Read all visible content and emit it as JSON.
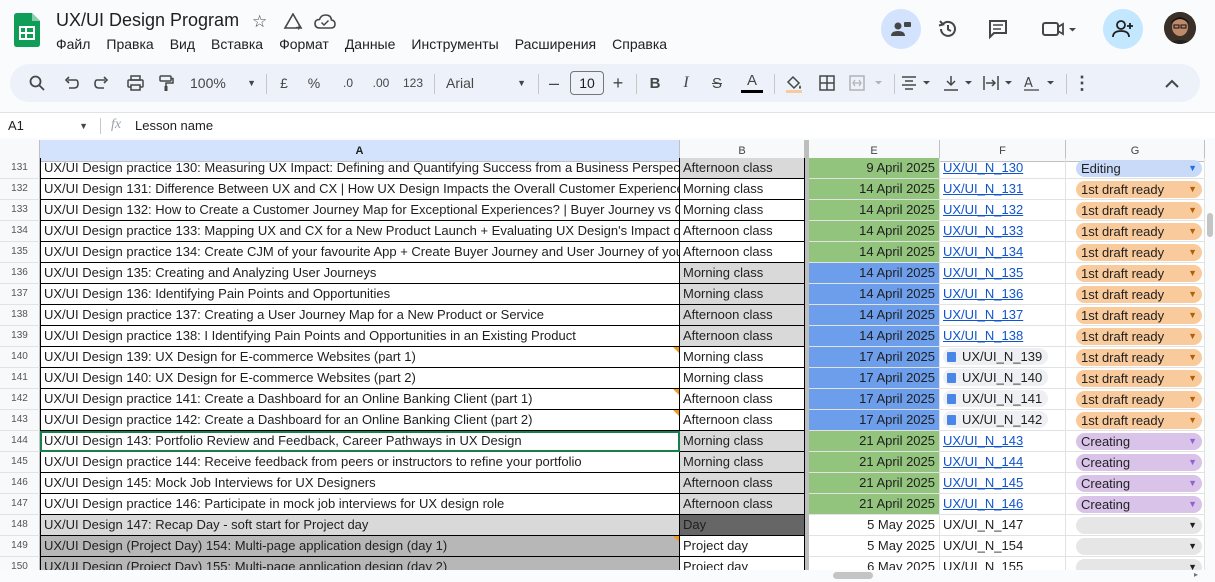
{
  "doc": {
    "title": "UX/UI Design Program",
    "menu": [
      "Файл",
      "Правка",
      "Вид",
      "Вставка",
      "Формат",
      "Данные",
      "Инструменты",
      "Расширения",
      "Справка"
    ]
  },
  "toolbar": {
    "zoom": "100%",
    "currency": "£",
    "percent": "%",
    "dec_decrease": ".0",
    "dec_increase": ".00",
    "number_format": "123",
    "font": "Arial",
    "font_size": "10",
    "bold": "B",
    "italic": "I",
    "strike": "S",
    "text_color": "A"
  },
  "formula": {
    "cell_ref": "A1",
    "fx": "fx",
    "value": "Lesson name"
  },
  "columns": [
    {
      "key": "A",
      "label": "A"
    },
    {
      "key": "B",
      "label": "B"
    },
    {
      "key": "E",
      "label": "E"
    },
    {
      "key": "F",
      "label": "F"
    },
    {
      "key": "G",
      "label": "G"
    }
  ],
  "colors": {
    "green": "#93c47d",
    "blue": "#6d9eeb",
    "gray_light": "#d9d9d9",
    "gray_mid": "#b7b7b7",
    "gray_dark": "#666666",
    "status_editing": "#c9daf8",
    "status_draft": "#f9cb9c",
    "status_creating": "#d9c3e9",
    "status_empty": "#e6e6e6"
  },
  "rows": [
    {
      "num": "131",
      "a": "UX/UI Design practice 130: Measuring UX Impact: Defining and Quantifying Success from a Business Perspective",
      "b": "Afternoon class",
      "bbg": "gray_light",
      "abg": "",
      "e": "9 April 2025",
      "ebg": "green",
      "f": "UX/UI_N_130",
      "ftype": "link",
      "g": "Editing",
      "gtype": "status_editing",
      "mark": false
    },
    {
      "num": "132",
      "a": "UX/UI Design 131: Difference Between UX and CX | How UX Design Impacts the Overall Customer Experience",
      "b": "Morning class",
      "bbg": "",
      "abg": "",
      "e": "14 April 2025",
      "ebg": "green",
      "f": "UX/UI_N_131",
      "ftype": "link",
      "g": "1st draft ready",
      "gtype": "status_draft",
      "mark": false
    },
    {
      "num": "133",
      "a": "UX/UI Design 132: How to Create a Customer Journey Map for Exceptional Experiences? | Buyer Journey vs CJM",
      "b": "Morning class",
      "bbg": "",
      "abg": "",
      "e": "14 April 2025",
      "ebg": "green",
      "f": "UX/UI_N_132",
      "ftype": "link",
      "g": "1st draft ready",
      "gtype": "status_draft",
      "mark": false
    },
    {
      "num": "134",
      "a": "UX/UI Design practice 133: Mapping UX and CX for a New Product Launch + Evaluating UX Design's Impact on CX",
      "b": "Afternoon class",
      "bbg": "",
      "abg": "",
      "e": "14 April 2025",
      "ebg": "green",
      "f": "UX/UI_N_133",
      "ftype": "link",
      "g": "1st draft ready",
      "gtype": "status_draft",
      "mark": false
    },
    {
      "num": "135",
      "a": "UX/UI Design practice 134: Create CJM of your favourite App + Create Buyer Journey and User Journey of your App",
      "b": "Afternoon class",
      "bbg": "",
      "abg": "",
      "e": "14 April 2025",
      "ebg": "green",
      "f": "UX/UI_N_134",
      "ftype": "link",
      "g": "1st draft ready",
      "gtype": "status_draft",
      "mark": false
    },
    {
      "num": "136",
      "a": "UX/UI Design 135: Creating and Analyzing User Journeys",
      "b": "Morning class",
      "bbg": "gray_light",
      "abg": "",
      "e": "14 April 2025",
      "ebg": "blue",
      "f": "UX/UI_N_135",
      "ftype": "link",
      "g": "1st draft ready",
      "gtype": "status_draft",
      "mark": false
    },
    {
      "num": "137",
      "a": "UX/UI Design 136: Identifying Pain Points and Opportunities",
      "b": "Morning class",
      "bbg": "gray_light",
      "abg": "",
      "e": "14 April 2025",
      "ebg": "blue",
      "f": "UX/UI_N_136",
      "ftype": "link",
      "g": "1st draft ready",
      "gtype": "status_draft",
      "mark": false
    },
    {
      "num": "138",
      "a": "UX/UI Design practice 137: Creating a User Journey Map for a New Product or Service",
      "b": "Afternoon class",
      "bbg": "gray_light",
      "abg": "",
      "e": "14 April 2025",
      "ebg": "blue",
      "f": "UX/UI_N_137",
      "ftype": "link",
      "g": "1st draft ready",
      "gtype": "status_draft",
      "mark": false
    },
    {
      "num": "139",
      "a": "UX/UI Design practice 138: I Identifying Pain Points and Opportunities in an Existing Product",
      "b": "Afternoon class",
      "bbg": "gray_light",
      "abg": "",
      "e": "14 April 2025",
      "ebg": "blue",
      "f": "UX/UI_N_138",
      "ftype": "link",
      "g": "1st draft ready",
      "gtype": "status_draft",
      "mark": false
    },
    {
      "num": "140",
      "a": "UX/UI Design 139: UX Design for E-commerce Websites (part 1)",
      "b": "Morning class",
      "bbg": "",
      "abg": "",
      "e": "17 April 2025",
      "ebg": "blue",
      "f": "UX/UI_N_139",
      "ftype": "chip",
      "g": "1st draft ready",
      "gtype": "status_draft",
      "mark": true
    },
    {
      "num": "141",
      "a": "UX/UI Design 140: UX Design for E-commerce Websites (part 2)",
      "b": "Morning class",
      "bbg": "",
      "abg": "",
      "e": "17 April 2025",
      "ebg": "blue",
      "f": "UX/UI_N_140",
      "ftype": "chip",
      "g": "1st draft ready",
      "gtype": "status_draft",
      "mark": false
    },
    {
      "num": "142",
      "a": "UX/UI Design practice 141: Create a Dashboard for an Online Banking Client (part 1)",
      "b": "Afternoon class",
      "bbg": "",
      "abg": "",
      "e": "17 April 2025",
      "ebg": "blue",
      "f": "UX/UI_N_141",
      "ftype": "chip",
      "g": "1st draft ready",
      "gtype": "status_draft",
      "mark": true
    },
    {
      "num": "143",
      "a": "UX/UI Design practice 142: Create a Dashboard for an Online Banking Client (part 2)",
      "b": "Afternoon class",
      "bbg": "",
      "abg": "",
      "e": "17 April 2025",
      "ebg": "blue",
      "f": "UX/UI_N_142",
      "ftype": "chip",
      "g": "1st draft ready",
      "gtype": "status_draft",
      "mark": true
    },
    {
      "num": "144",
      "a": "UX/UI Design 143: Portfolio Review and Feedback, Career Pathways in UX Design",
      "b": "Morning class",
      "bbg": "gray_light",
      "abg": "",
      "e": "21 April 2025",
      "ebg": "green",
      "f": "UX/UI_N_143",
      "ftype": "link",
      "g": "Creating",
      "gtype": "status_creating",
      "mark": false,
      "selected": true
    },
    {
      "num": "145",
      "a": "UX/UI Design practice 144: Receive feedback from peers or instructors to refine your portfolio",
      "b": "Morning class",
      "bbg": "gray_light",
      "abg": "",
      "e": "21 April 2025",
      "ebg": "green",
      "f": "UX/UI_N_144",
      "ftype": "link",
      "g": "Creating",
      "gtype": "status_creating",
      "mark": false
    },
    {
      "num": "146",
      "a": "UX/UI Design 145: Mock Job Interviews for UX Designers",
      "b": "Afternoon class",
      "bbg": "gray_light",
      "abg": "",
      "e": "21 April 2025",
      "ebg": "green",
      "f": "UX/UI_N_145",
      "ftype": "link",
      "g": "Creating",
      "gtype": "status_creating",
      "mark": false
    },
    {
      "num": "147",
      "a": "UX/UI Design practice 146: Participate in mock job interviews for UX design role",
      "b": "Afternoon class",
      "bbg": "gray_light",
      "abg": "",
      "e": "21 April 2025",
      "ebg": "green",
      "f": "UX/UI_N_146",
      "ftype": "link",
      "g": "Creating",
      "gtype": "status_creating",
      "mark": false
    },
    {
      "num": "148",
      "a": "UX/UI Design 147: Recap Day - soft start for Project day",
      "b": "Day",
      "bbg": "gray_dark",
      "abg": "gray_light",
      "e": "5 May 2025",
      "ebg": "",
      "f": "UX/UI_N_147",
      "ftype": "plain",
      "g": "",
      "gtype": "status_empty",
      "mark": false
    },
    {
      "num": "149",
      "a": "UX/UI Design (Project Day) 154: Multi-page application design (day 1)",
      "b": "Project day",
      "bbg": "",
      "abg": "gray_mid",
      "e": "5 May 2025",
      "ebg": "",
      "f": "UX/UI_N_154",
      "ftype": "plain",
      "g": "",
      "gtype": "status_empty",
      "mark": true
    },
    {
      "num": "150",
      "a": "UX/UI Design (Project Day) 155: Multi-page application design (day 2)",
      "b": "Project day",
      "bbg": "",
      "abg": "gray_mid",
      "e": "6 May 2025",
      "ebg": "",
      "f": "UX/UI_N_155",
      "ftype": "plain",
      "g": "",
      "gtype": "status_empty",
      "mark": false
    }
  ]
}
